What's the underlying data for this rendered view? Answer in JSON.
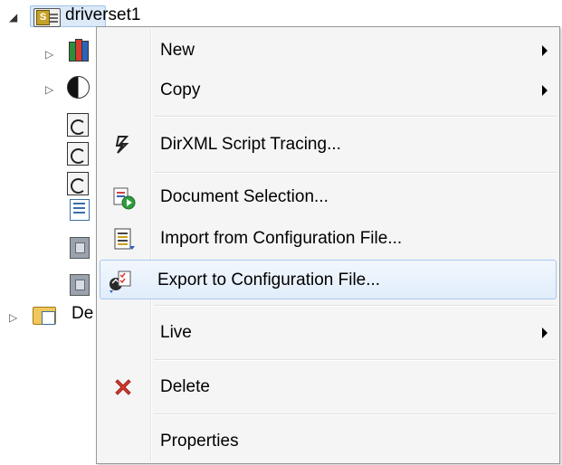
{
  "tree": {
    "root": {
      "label": "driverset1",
      "expanded": true,
      "selected": true,
      "icon": "driverset-icon"
    },
    "children": [
      {
        "icon": "library-icon",
        "expandable": true
      },
      {
        "icon": "yin-yang-icon",
        "expandable": true
      },
      {
        "icon": "policy-icon"
      },
      {
        "icon": "policy-icon"
      },
      {
        "icon": "policy-icon"
      },
      {
        "icon": "list-document-icon"
      },
      {
        "icon": "grey-object-icon"
      },
      {
        "icon": "grey-object-icon"
      }
    ],
    "sibling": {
      "label": "De",
      "icon": "folder-icon",
      "expandable": true
    }
  },
  "menu": {
    "items": [
      {
        "label": "New",
        "submenu": true,
        "icon": ""
      },
      {
        "label": "Copy",
        "submenu": true,
        "icon": ""
      },
      {
        "label": "DirXML Script Tracing...",
        "icon": "lightning-icon"
      },
      {
        "label": "Document Selection...",
        "icon": "document-selection-icon"
      },
      {
        "label": "Import from Configuration File...",
        "icon": "import-config-icon"
      },
      {
        "label": "Export to Configuration File...",
        "icon": "export-config-icon",
        "highlighted": true
      },
      {
        "label": "Live",
        "submenu": true,
        "icon": ""
      },
      {
        "label": "Delete",
        "icon": "delete-icon",
        "color": "#d63b2e"
      },
      {
        "label": "Properties",
        "icon": ""
      }
    ]
  },
  "colors": {
    "selection": "#dbe9f9",
    "highlight_border": "#a8c8ee",
    "menu_bg": "#f5f5f5"
  }
}
